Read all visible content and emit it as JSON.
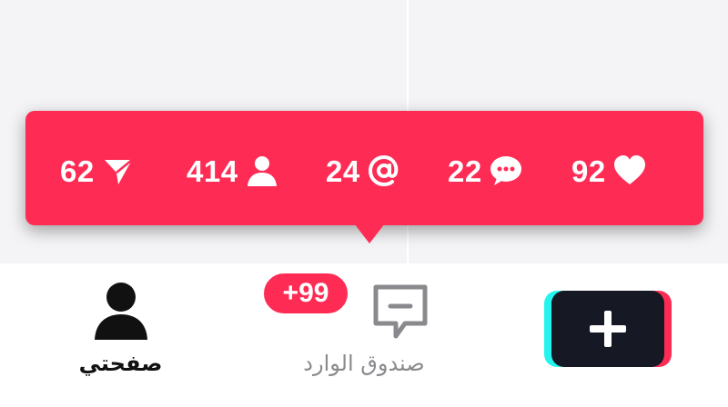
{
  "colors": {
    "accent": "#fe2c55",
    "cyan": "#25f4ee",
    "dark": "#161823",
    "muted": "#8a8a8e"
  },
  "notification_bubble": {
    "stats": [
      {
        "name": "shares",
        "icon": "send-arrow-icon",
        "count": "62"
      },
      {
        "name": "followers",
        "icon": "person-icon",
        "count": "414"
      },
      {
        "name": "mentions",
        "icon": "at-sign-icon",
        "count": "24"
      },
      {
        "name": "comments",
        "icon": "comment-bubble-icon",
        "count": "22"
      },
      {
        "name": "likes",
        "icon": "heart-icon",
        "count": "92"
      }
    ]
  },
  "bottom_nav": {
    "me": {
      "label": "صفحتي",
      "icon": "person-icon"
    },
    "inbox": {
      "label": "صندوق الوارد",
      "icon": "inbox-message-icon",
      "badge": "+99"
    },
    "create": {
      "icon": "plus-icon"
    }
  }
}
